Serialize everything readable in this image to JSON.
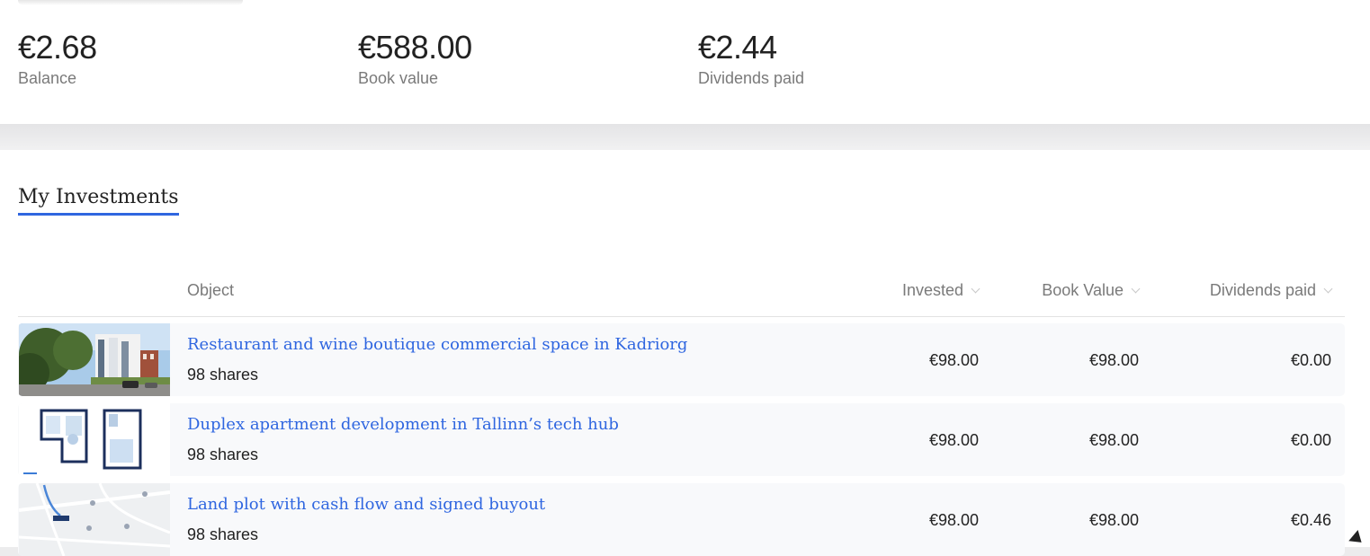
{
  "summary": [
    {
      "value": "€2.68",
      "label": "Balance"
    },
    {
      "value": "€588.00",
      "label": "Book value"
    },
    {
      "value": "€2.44",
      "label": "Dividends paid"
    }
  ],
  "section_title": "My Investments",
  "columns": {
    "object": "Object",
    "invested": "Invested",
    "book_value": "Book Value",
    "dividends_paid": "Dividends paid"
  },
  "investments": [
    {
      "title": "Restaurant and wine boutique commercial space in Kadriorg",
      "shares": "98 shares",
      "invested": "€98.00",
      "book_value": "€98.00",
      "dividends_paid": "€0.00",
      "thumb": "building-photo"
    },
    {
      "title": "Duplex apartment development in Tallinn’s tech hub",
      "shares": "98 shares",
      "invested": "€98.00",
      "book_value": "€98.00",
      "dividends_paid": "€0.00",
      "thumb": "floor-plan"
    },
    {
      "title": "Land plot with cash flow and signed buyout",
      "shares": "98 shares",
      "invested": "€98.00",
      "book_value": "€98.00",
      "dividends_paid": "€0.46",
      "thumb": "map"
    }
  ],
  "colors": {
    "accent": "#2f66e0",
    "row_bg": "#f8f9fb",
    "muted_text": "#7a7a7a"
  }
}
